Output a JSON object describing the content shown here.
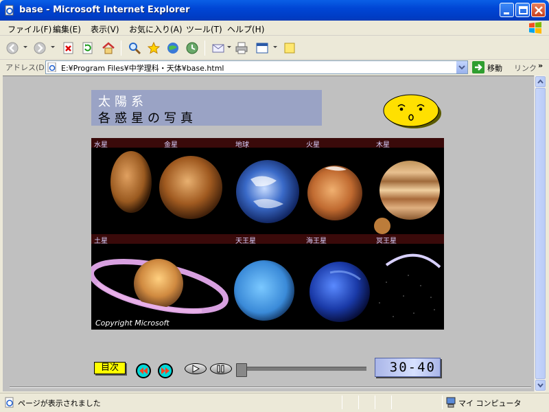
{
  "window": {
    "title": "base - Microsoft Internet Explorer"
  },
  "menu": [
    "ファイル(F)",
    "編集(E)",
    "表示(V)",
    "お気に入り(A)",
    "ツール(T)",
    "ヘルプ(H)"
  ],
  "address": {
    "label": "アドレス(D)",
    "value": "E:¥Program Files¥中学理科・天体¥base.html",
    "go": "移動",
    "links": "リンク"
  },
  "page": {
    "title_line1": "太陽系",
    "title_line2": "各惑星の写真",
    "planets_row1": [
      "水星",
      "金星",
      "地球",
      "火星",
      "木星"
    ],
    "planets_row2": [
      "土星",
      "天王星",
      "海王星",
      "冥王星"
    ],
    "copyright": "Copyright Microsoft",
    "nav_button": "目次",
    "counter": "30-40"
  },
  "status": {
    "text": "ページが表示されました",
    "zone": "マイ コンピュータ"
  },
  "colors": {
    "title_panel": "#9aa3c5",
    "mokuji": "#ffff00",
    "nav_round": "#00d7d7"
  }
}
